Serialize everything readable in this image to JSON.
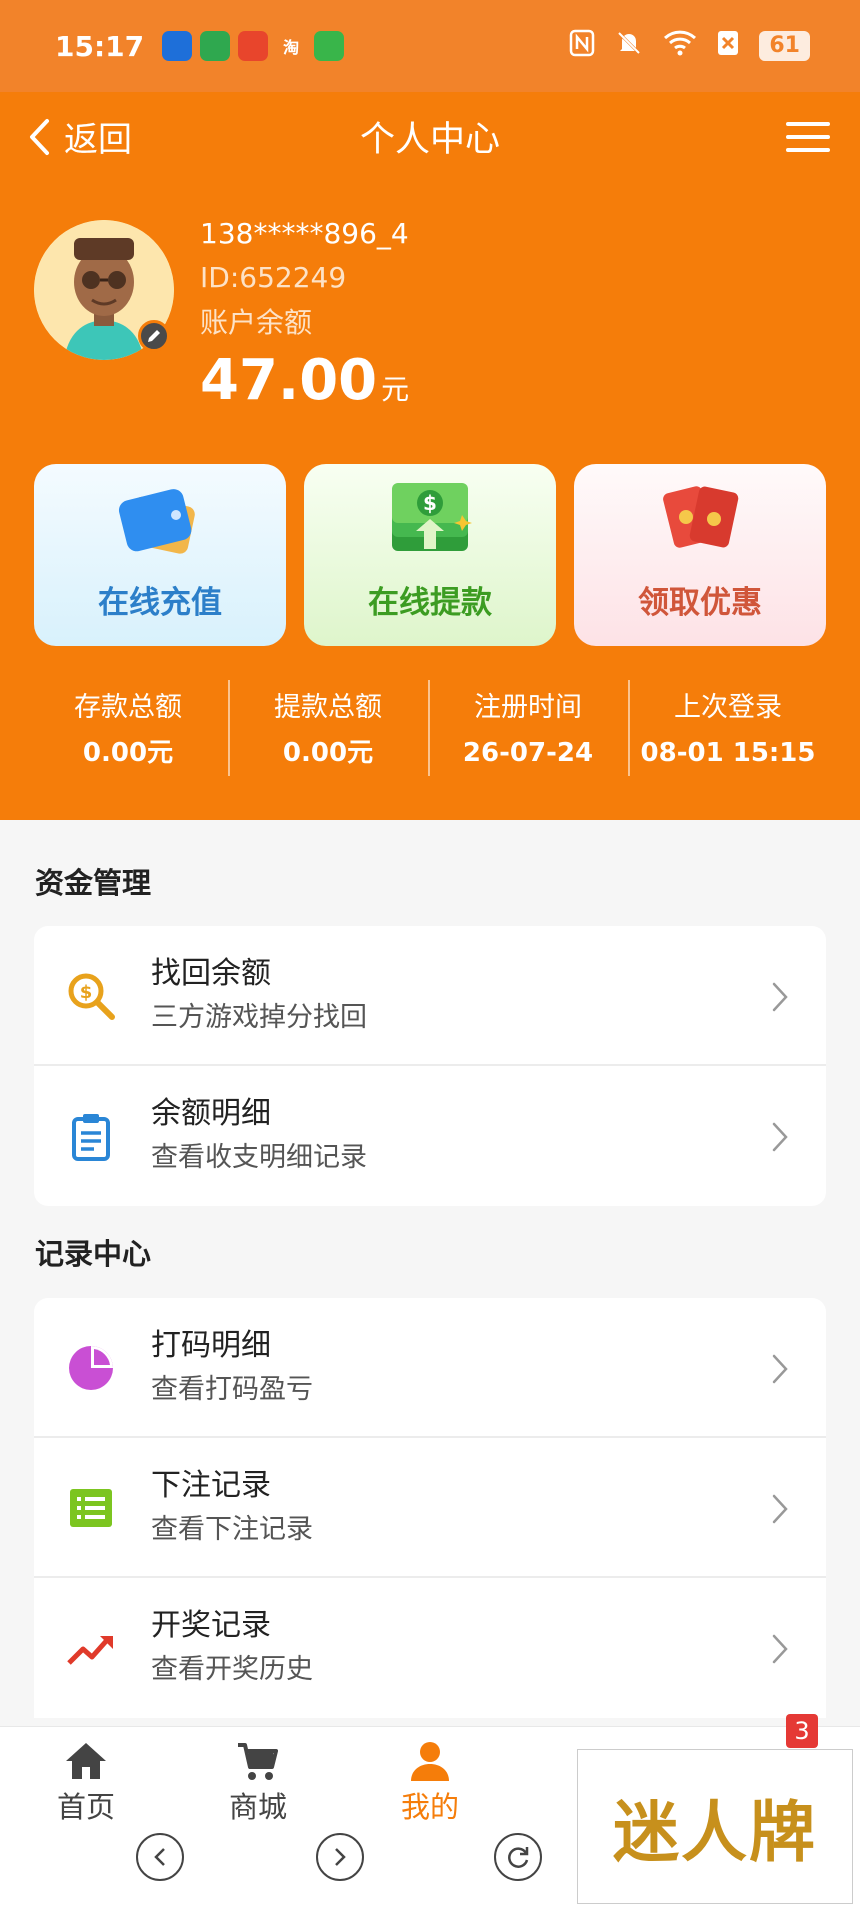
{
  "status_bar": {
    "time": "15:17",
    "battery": "61",
    "apps": [
      "",
      "",
      "",
      "淘",
      ""
    ]
  },
  "nav": {
    "back_label": "返回",
    "title": "个人中心"
  },
  "profile": {
    "phone": "138*****896_4",
    "id": "ID:652249",
    "balance_label": "账户余额",
    "balance": "47.00",
    "balance_unit": "元"
  },
  "actions": [
    {
      "label": "在线充值",
      "color": "#2c7fc9"
    },
    {
      "label": "在线提款",
      "color": "#3c9c22"
    },
    {
      "label": "领取优惠",
      "color": "#d0563a"
    }
  ],
  "stats": [
    {
      "label": "存款总额",
      "value": "0.00元"
    },
    {
      "label": "提款总额",
      "value": "0.00元"
    },
    {
      "label": "注册时间",
      "value": "26-07-24"
    },
    {
      "label": "上次登录",
      "value": "08-01 15:15"
    }
  ],
  "sections": {
    "funds_title": "资金管理",
    "funds": [
      {
        "title": "找回余额",
        "sub": "三方游戏掉分找回",
        "icon": "search-money-icon"
      },
      {
        "title": "余额明细",
        "sub": "查看收支明细记录",
        "icon": "clipboard-icon"
      }
    ],
    "records_title": "记录中心",
    "records": [
      {
        "title": "打码明细",
        "sub": "查看打码盈亏",
        "icon": "pie-chart-icon"
      },
      {
        "title": "下注记录",
        "sub": "查看下注记录",
        "icon": "list-icon"
      },
      {
        "title": "开奖记录",
        "sub": "查看开奖历史",
        "icon": "trend-icon"
      }
    ]
  },
  "tabbar": {
    "tabs": [
      {
        "label": "首页",
        "icon": "home-icon"
      },
      {
        "label": "商城",
        "icon": "cart-icon"
      },
      {
        "label": "我的",
        "icon": "user-icon",
        "active": true
      }
    ],
    "badge": "3"
  },
  "brand": {
    "text": "迷人牌"
  },
  "colors": {
    "primary": "#f57d0a",
    "status_bar": "#f2832a",
    "background": "#f6f6f6"
  }
}
